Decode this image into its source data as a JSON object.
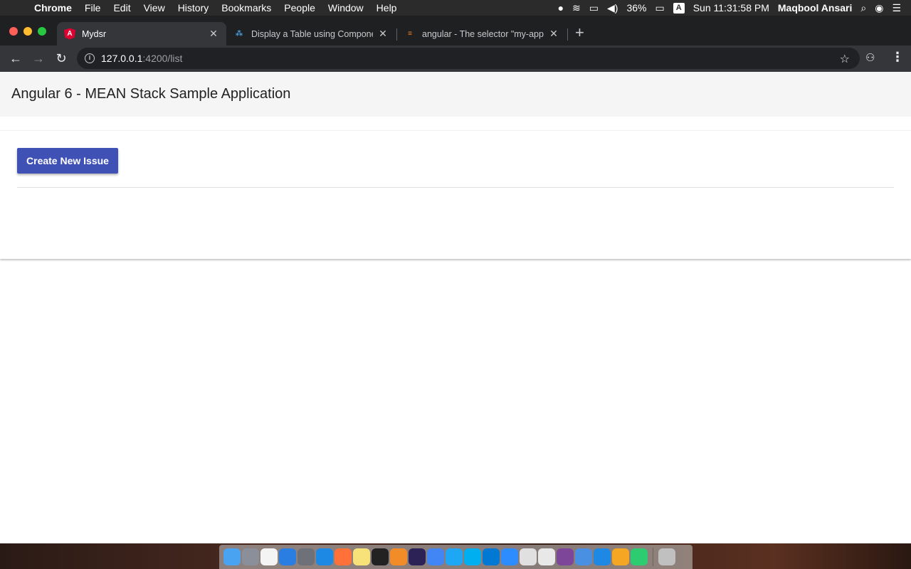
{
  "menubar": {
    "app_name": "Chrome",
    "items": [
      "File",
      "Edit",
      "View",
      "History",
      "Bookmarks",
      "People",
      "Window",
      "Help"
    ],
    "battery": "36%",
    "input_source": "A",
    "clock": "Sun 11:31:58 PM",
    "user": "Maqbool Ansari"
  },
  "tabs": [
    {
      "title": "Mydsr",
      "favicon": "angular-icon",
      "active": true
    },
    {
      "title": "Display a Table using Compone",
      "favicon": "dots-icon",
      "active": false
    },
    {
      "title": "angular - The selector \"my-app",
      "favicon": "stackoverflow-icon",
      "active": false
    }
  ],
  "address_bar": {
    "host": "127.0.0.1",
    "path": ":4200/list"
  },
  "app": {
    "title": "Angular 6 - MEAN Stack Sample Application",
    "create_button": "Create New Issue"
  },
  "colors": {
    "primary": "#3f51b5",
    "header_bg": "#f5f5f5",
    "chrome_dark": "#35363a"
  },
  "dock": {
    "icons": [
      "finder-icon",
      "launchpad-icon",
      "calendar-icon",
      "xcode-icon",
      "system-preferences-icon",
      "vscode-icon",
      "firefox-icon",
      "notes-icon",
      "terminal-icon",
      "sublime-icon",
      "eclipse-icon",
      "chrome-icon",
      "safari-icon",
      "skype-icon",
      "skype-business-icon",
      "zoom-icon",
      "preview-icon",
      "slack-icon",
      "tor-icon",
      "finder-alt-icon",
      "xcode-alt-icon",
      "transmit-icon",
      "sourcetree-icon",
      "trash-icon"
    ]
  }
}
